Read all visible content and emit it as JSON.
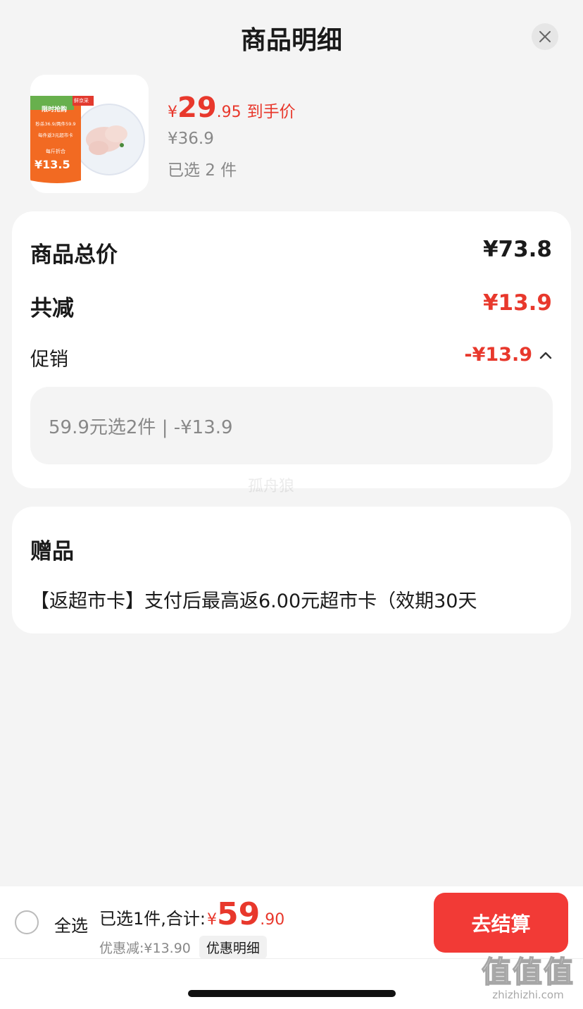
{
  "header": {
    "title": "商品明细"
  },
  "product": {
    "price_symbol": "¥",
    "price_int": "29",
    "price_dec": ".95",
    "price_tag": "到手价",
    "original_price": "¥36.9",
    "selected_count": "已选 2 件",
    "thumb": {
      "badge_top": "限时抢购",
      "line1": "秒杀36.9/两件59.9",
      "line2": "每件返3元超市卡",
      "line3": "每斤折合",
      "price": "¥13.5",
      "brand": "鲜京采"
    }
  },
  "price_card": {
    "total_label": "商品总价",
    "total_value": "¥73.8",
    "reduce_label": "共减",
    "reduce_value": "¥13.9",
    "promo_label": "促销",
    "promo_value": "-¥13.9",
    "promo_detail": "59.9元选2件 | -¥13.9"
  },
  "watermark": "孤舟狼",
  "gift_card": {
    "title": "赠品",
    "text": "【返超市卡】支付后最高返6.00元超市卡（效期30天"
  },
  "bottom_bar": {
    "select_all": "全选",
    "total_label": "已选1件,合计:",
    "total_symbol": "¥",
    "total_int": "59",
    "total_dec": ".90",
    "discount_text": "优惠减:¥13.90",
    "discount_detail": "优惠明细",
    "checkout": "去结算"
  },
  "site_mark": {
    "big": "值值值",
    "small": "zhizhizhi.com"
  },
  "colors": {
    "accent": "#e8382c",
    "checkout": "#f23a36"
  }
}
